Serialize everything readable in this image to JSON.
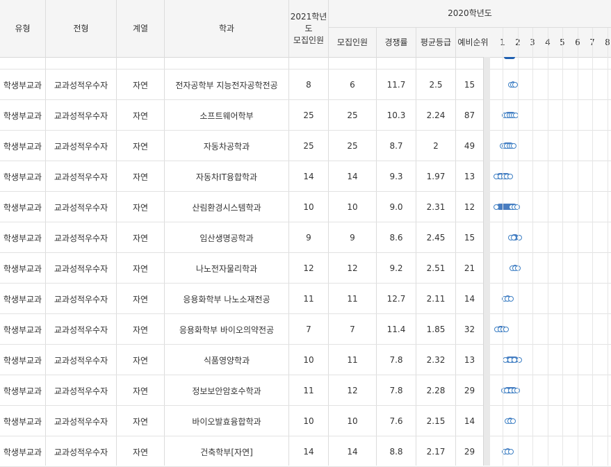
{
  "header": {
    "type": "유형",
    "admission": "전형",
    "track": "계열",
    "dept": "학과",
    "quota2021_line1": "2021학년도",
    "quota2021_line2": "모집인원",
    "year2020": "2020학년도",
    "quota2020": "모집인원",
    "competition": "경쟁률",
    "avg_grade": "평균등급",
    "waitlist": "예비순위",
    "scale": [
      "1",
      "2",
      "3",
      "4",
      "5",
      "6",
      "7",
      "8"
    ]
  },
  "rows": [
    {
      "type": "학생부교과",
      "admission": "교과성적우수자",
      "track": "자연",
      "dept": "전자공학부 지능전자공학전공",
      "q2021": "8",
      "q2020": "6",
      "competition": "11.7",
      "avg": "2.5",
      "wait": "15",
      "grades": [
        1.45,
        1.6,
        1.75
      ]
    },
    {
      "type": "학생부교과",
      "admission": "교과성적우수자",
      "track": "자연",
      "dept": "소프트웨어학부",
      "q2021": "25",
      "q2020": "25",
      "competition": "10.3",
      "avg": "2.24",
      "wait": "87",
      "grades": [
        1.05,
        1.2,
        1.35,
        1.5,
        1.65,
        1.8
      ]
    },
    {
      "type": "학생부교과",
      "admission": "교과성적우수자",
      "track": "자연",
      "dept": "자동차공학과",
      "q2021": "25",
      "q2020": "25",
      "competition": "8.7",
      "avg": "2",
      "wait": "49",
      "grades": [
        0.9,
        1.05,
        1.2,
        1.35,
        1.5,
        1.65
      ]
    },
    {
      "type": "학생부교과",
      "admission": "교과성적우수자",
      "track": "자연",
      "dept": "자동차IT융합학과",
      "q2021": "14",
      "q2020": "14",
      "competition": "9.3",
      "avg": "1.97",
      "wait": "13",
      "grades": [
        0.5,
        0.75,
        1.0,
        1.2,
        1.4
      ]
    },
    {
      "type": "학생부교과",
      "admission": "교과성적우수자",
      "track": "자연",
      "dept": "산림환경시스템학과",
      "q2021": "10",
      "q2020": "10",
      "competition": "9.0",
      "avg": "2.31",
      "wait": "12",
      "grades": [
        0.5,
        1.5,
        1.7,
        1.9
      ]
    },
    {
      "type": "학생부교과",
      "admission": "교과성적우수자",
      "track": "자연",
      "dept": "임산생명공학과",
      "q2021": "9",
      "q2020": "9",
      "competition": "8.6",
      "avg": "2.45",
      "wait": "15",
      "grades": [
        1.45,
        1.65,
        2.0
      ]
    },
    {
      "type": "학생부교과",
      "admission": "교과성적우수자",
      "track": "자연",
      "dept": "나노전자물리학과",
      "q2021": "12",
      "q2020": "12",
      "competition": "9.2",
      "avg": "2.51",
      "wait": "21",
      "grades": [
        1.55,
        1.75,
        1.95
      ]
    },
    {
      "type": "학생부교과",
      "admission": "교과성적우수자",
      "track": "자연",
      "dept": "응용화학부 나노소재전공",
      "q2021": "11",
      "q2020": "11",
      "competition": "12.7",
      "avg": "2.11",
      "wait": "14",
      "grades": [
        1.05,
        1.25,
        1.45
      ]
    },
    {
      "type": "학생부교과",
      "admission": "교과성적우수자",
      "track": "자연",
      "dept": "응용화학부 바이오의약전공",
      "q2021": "7",
      "q2020": "7",
      "competition": "11.4",
      "avg": "1.85",
      "wait": "32",
      "grades": [
        0.55,
        0.75,
        0.95,
        1.15
      ]
    },
    {
      "type": "학생부교과",
      "admission": "교과성적우수자",
      "track": "자연",
      "dept": "식품영양학과",
      "q2021": "10",
      "q2020": "11",
      "competition": "7.8",
      "avg": "2.32",
      "wait": "13",
      "grades": [
        1.1,
        1.4,
        1.7,
        2.0
      ]
    },
    {
      "type": "학생부교과",
      "admission": "교과성적우수자",
      "track": "자연",
      "dept": "정보보안암호수학과",
      "q2021": "11",
      "q2020": "12",
      "competition": "7.8",
      "avg": "2.28",
      "wait": "29",
      "grades": [
        1.0,
        1.2,
        1.45,
        1.7,
        1.9
      ]
    },
    {
      "type": "학생부교과",
      "admission": "교과성적우수자",
      "track": "자연",
      "dept": "바이오발효융합학과",
      "q2021": "10",
      "q2020": "10",
      "competition": "7.6",
      "avg": "2.15",
      "wait": "14",
      "grades": [
        1.25,
        1.4,
        1.6
      ]
    },
    {
      "type": "학생부교과",
      "admission": "교과성적우수자",
      "track": "자연",
      "dept": "건축학부[자연]",
      "q2021": "14",
      "q2020": "14",
      "competition": "8.8",
      "avg": "2.17",
      "wait": "29",
      "grades": [
        1.05,
        1.25,
        1.45
      ]
    }
  ]
}
